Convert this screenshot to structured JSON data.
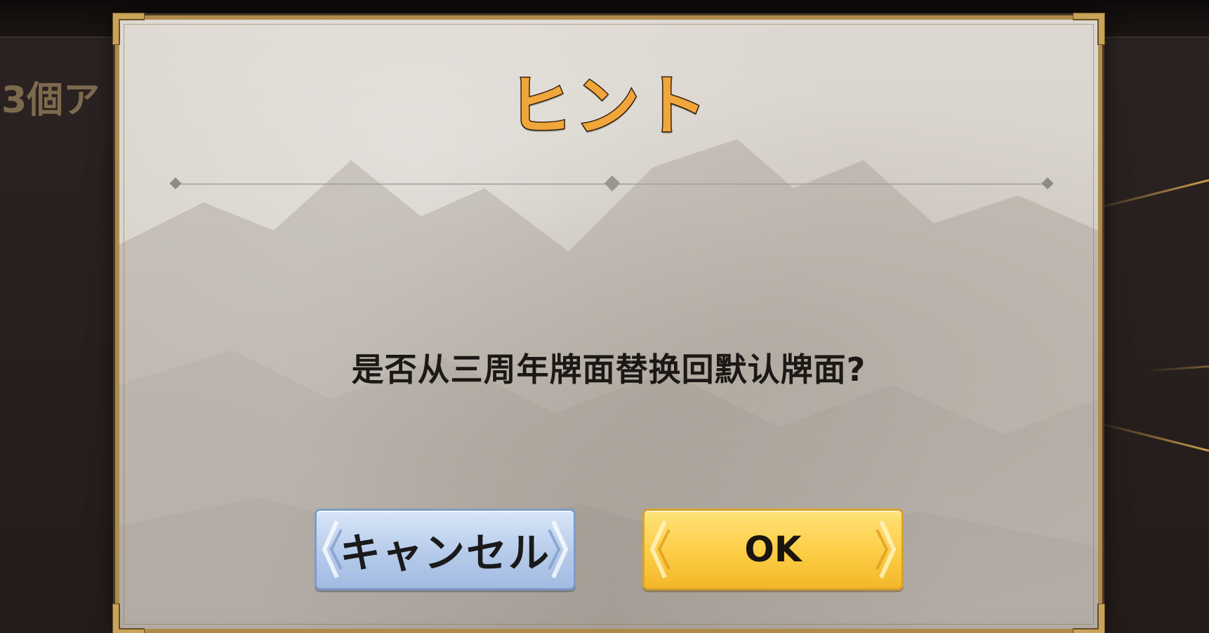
{
  "background": {
    "top_text": "",
    "side_text": "3個ア"
  },
  "dialog": {
    "title": "ヒント",
    "message": "是否从三周年牌面替换回默认牌面?",
    "buttons": {
      "cancel_label": "キャンセル",
      "ok_label": "OK"
    }
  },
  "colors": {
    "title": "#f0a63a",
    "frame_gold": "#b08a4c",
    "cancel_button": "#b6cbea",
    "ok_button": "#fccd44",
    "dialog_bg": "#d6d1ca"
  },
  "icons": {
    "divider_ornament": "diamond",
    "button_ornament": "chevron"
  }
}
